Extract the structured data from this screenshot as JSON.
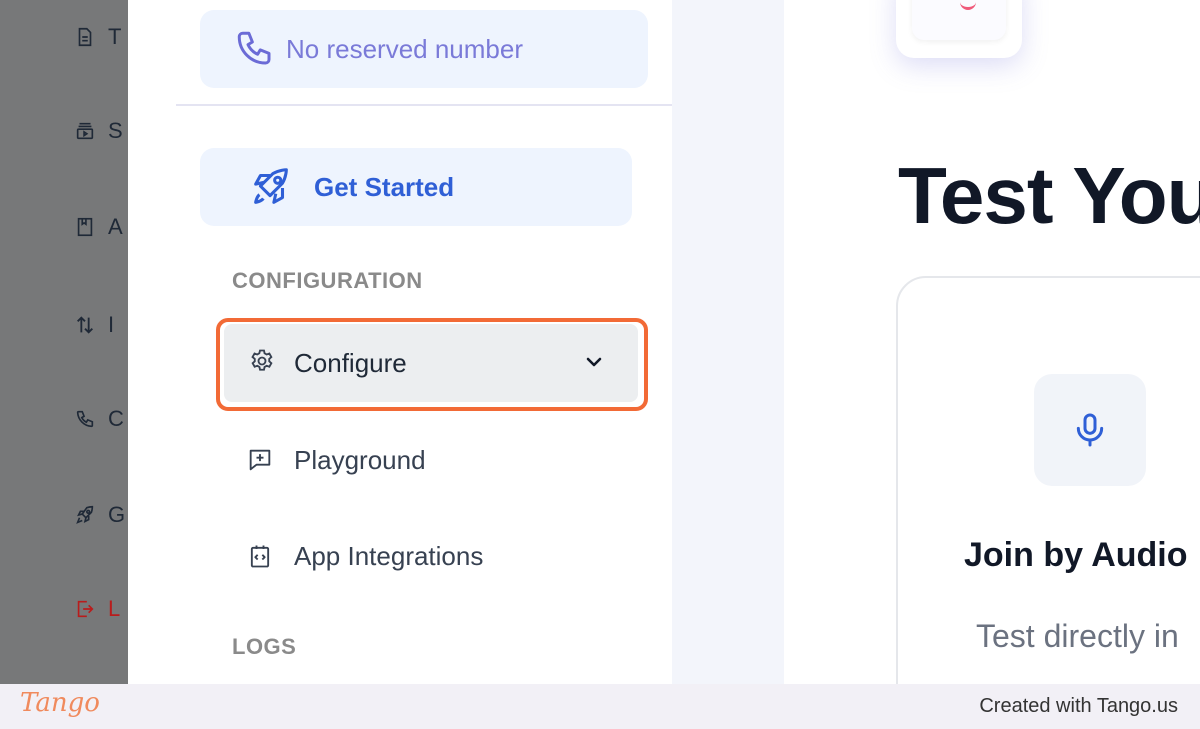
{
  "rail": {
    "items": [
      {
        "icon": "document-icon",
        "label": "T"
      },
      {
        "icon": "media-stack-icon",
        "label": "S"
      },
      {
        "icon": "book-icon",
        "label": "A"
      },
      {
        "icon": "up-down-arrows-icon",
        "label": "I"
      },
      {
        "icon": "phone-icon",
        "label": "C"
      },
      {
        "icon": "rocket-icon",
        "label": "G"
      },
      {
        "icon": "logout-icon",
        "label": "L"
      }
    ]
  },
  "sidebar": {
    "reserved_number": "No reserved number",
    "get_started": "Get Started",
    "section_configuration": "CONFIGURATION",
    "configure": "Configure",
    "playground": "Playground",
    "app_integrations": "App Integrations",
    "section_logs": "LOGS"
  },
  "content": {
    "title": "Test You",
    "card_title": "Join by Audio",
    "card_text": "Test directly in"
  },
  "footer": {
    "brand": "Tango",
    "credit": "Created with Tango.us"
  },
  "colors": {
    "accent": "#2f5fd6",
    "highlight": "#f26a36",
    "danger": "#b91c1c"
  }
}
